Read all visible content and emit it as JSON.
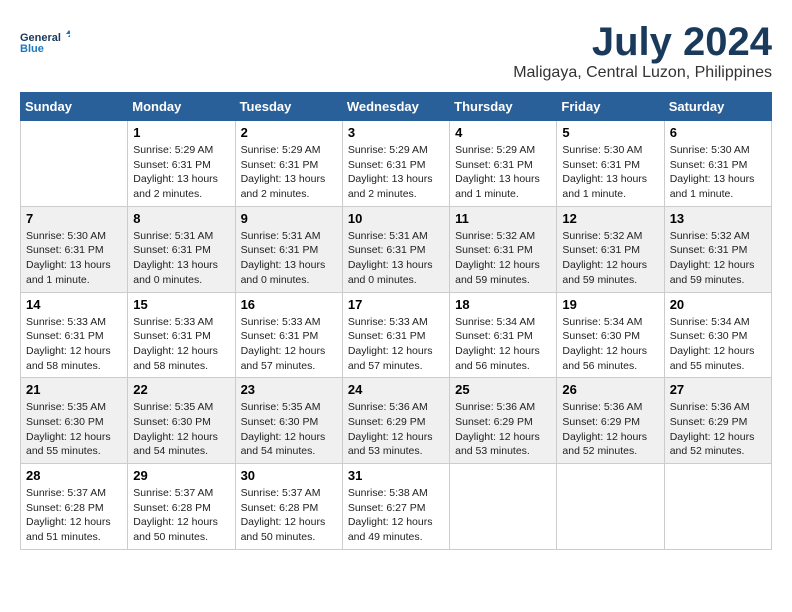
{
  "logo": {
    "line1": "General",
    "line2": "Blue"
  },
  "title": "July 2024",
  "subtitle": "Maligaya, Central Luzon, Philippines",
  "header_days": [
    "Sunday",
    "Monday",
    "Tuesday",
    "Wednesday",
    "Thursday",
    "Friday",
    "Saturday"
  ],
  "weeks": [
    {
      "cells": [
        {
          "day": "",
          "info": ""
        },
        {
          "day": "1",
          "info": "Sunrise: 5:29 AM\nSunset: 6:31 PM\nDaylight: 13 hours\nand 2 minutes."
        },
        {
          "day": "2",
          "info": "Sunrise: 5:29 AM\nSunset: 6:31 PM\nDaylight: 13 hours\nand 2 minutes."
        },
        {
          "day": "3",
          "info": "Sunrise: 5:29 AM\nSunset: 6:31 PM\nDaylight: 13 hours\nand 2 minutes."
        },
        {
          "day": "4",
          "info": "Sunrise: 5:29 AM\nSunset: 6:31 PM\nDaylight: 13 hours\nand 1 minute."
        },
        {
          "day": "5",
          "info": "Sunrise: 5:30 AM\nSunset: 6:31 PM\nDaylight: 13 hours\nand 1 minute."
        },
        {
          "day": "6",
          "info": "Sunrise: 5:30 AM\nSunset: 6:31 PM\nDaylight: 13 hours\nand 1 minute."
        }
      ]
    },
    {
      "cells": [
        {
          "day": "7",
          "info": "Sunrise: 5:30 AM\nSunset: 6:31 PM\nDaylight: 13 hours\nand 1 minute."
        },
        {
          "day": "8",
          "info": "Sunrise: 5:31 AM\nSunset: 6:31 PM\nDaylight: 13 hours\nand 0 minutes."
        },
        {
          "day": "9",
          "info": "Sunrise: 5:31 AM\nSunset: 6:31 PM\nDaylight: 13 hours\nand 0 minutes."
        },
        {
          "day": "10",
          "info": "Sunrise: 5:31 AM\nSunset: 6:31 PM\nDaylight: 13 hours\nand 0 minutes."
        },
        {
          "day": "11",
          "info": "Sunrise: 5:32 AM\nSunset: 6:31 PM\nDaylight: 12 hours\nand 59 minutes."
        },
        {
          "day": "12",
          "info": "Sunrise: 5:32 AM\nSunset: 6:31 PM\nDaylight: 12 hours\nand 59 minutes."
        },
        {
          "day": "13",
          "info": "Sunrise: 5:32 AM\nSunset: 6:31 PM\nDaylight: 12 hours\nand 59 minutes."
        }
      ]
    },
    {
      "cells": [
        {
          "day": "14",
          "info": "Sunrise: 5:33 AM\nSunset: 6:31 PM\nDaylight: 12 hours\nand 58 minutes."
        },
        {
          "day": "15",
          "info": "Sunrise: 5:33 AM\nSunset: 6:31 PM\nDaylight: 12 hours\nand 58 minutes."
        },
        {
          "day": "16",
          "info": "Sunrise: 5:33 AM\nSunset: 6:31 PM\nDaylight: 12 hours\nand 57 minutes."
        },
        {
          "day": "17",
          "info": "Sunrise: 5:33 AM\nSunset: 6:31 PM\nDaylight: 12 hours\nand 57 minutes."
        },
        {
          "day": "18",
          "info": "Sunrise: 5:34 AM\nSunset: 6:31 PM\nDaylight: 12 hours\nand 56 minutes."
        },
        {
          "day": "19",
          "info": "Sunrise: 5:34 AM\nSunset: 6:30 PM\nDaylight: 12 hours\nand 56 minutes."
        },
        {
          "day": "20",
          "info": "Sunrise: 5:34 AM\nSunset: 6:30 PM\nDaylight: 12 hours\nand 55 minutes."
        }
      ]
    },
    {
      "cells": [
        {
          "day": "21",
          "info": "Sunrise: 5:35 AM\nSunset: 6:30 PM\nDaylight: 12 hours\nand 55 minutes."
        },
        {
          "day": "22",
          "info": "Sunrise: 5:35 AM\nSunset: 6:30 PM\nDaylight: 12 hours\nand 54 minutes."
        },
        {
          "day": "23",
          "info": "Sunrise: 5:35 AM\nSunset: 6:30 PM\nDaylight: 12 hours\nand 54 minutes."
        },
        {
          "day": "24",
          "info": "Sunrise: 5:36 AM\nSunset: 6:29 PM\nDaylight: 12 hours\nand 53 minutes."
        },
        {
          "day": "25",
          "info": "Sunrise: 5:36 AM\nSunset: 6:29 PM\nDaylight: 12 hours\nand 53 minutes."
        },
        {
          "day": "26",
          "info": "Sunrise: 5:36 AM\nSunset: 6:29 PM\nDaylight: 12 hours\nand 52 minutes."
        },
        {
          "day": "27",
          "info": "Sunrise: 5:36 AM\nSunset: 6:29 PM\nDaylight: 12 hours\nand 52 minutes."
        }
      ]
    },
    {
      "cells": [
        {
          "day": "28",
          "info": "Sunrise: 5:37 AM\nSunset: 6:28 PM\nDaylight: 12 hours\nand 51 minutes."
        },
        {
          "day": "29",
          "info": "Sunrise: 5:37 AM\nSunset: 6:28 PM\nDaylight: 12 hours\nand 50 minutes."
        },
        {
          "day": "30",
          "info": "Sunrise: 5:37 AM\nSunset: 6:28 PM\nDaylight: 12 hours\nand 50 minutes."
        },
        {
          "day": "31",
          "info": "Sunrise: 5:38 AM\nSunset: 6:27 PM\nDaylight: 12 hours\nand 49 minutes."
        },
        {
          "day": "",
          "info": ""
        },
        {
          "day": "",
          "info": ""
        },
        {
          "day": "",
          "info": ""
        }
      ]
    }
  ]
}
